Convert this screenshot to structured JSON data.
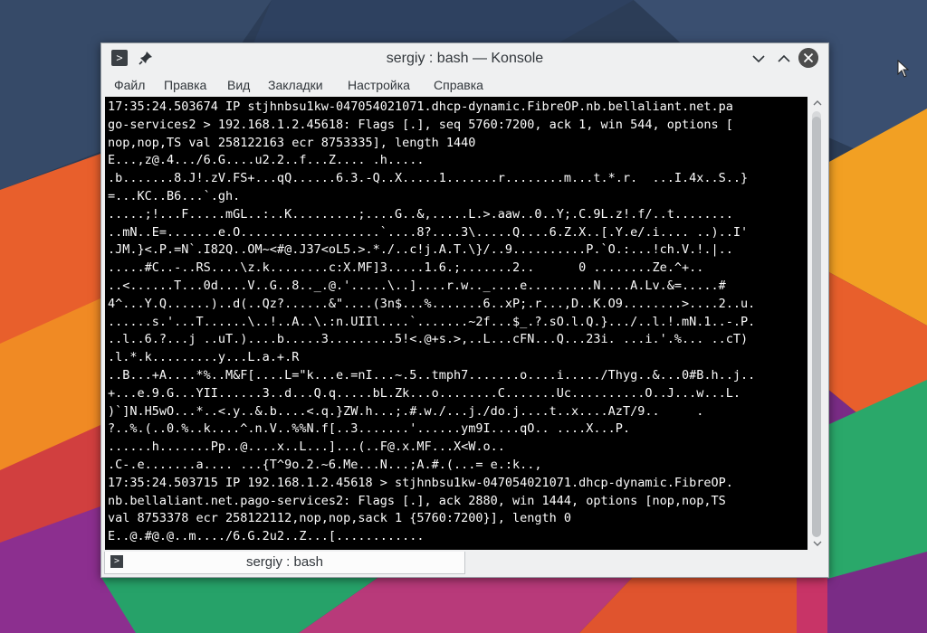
{
  "window": {
    "title": "sergiy : bash — Konsole",
    "prompt_glyph": ">"
  },
  "menu": {
    "items": [
      {
        "label": "Файл"
      },
      {
        "label": "Правка"
      },
      {
        "label": "Вид"
      },
      {
        "label": "Закладки"
      },
      {
        "label": "Настройка"
      },
      {
        "label": "Справка"
      }
    ]
  },
  "terminal": {
    "lines": [
      "17:35:24.503674 IP stjhnbsu1kw-047054021071.dhcp-dynamic.FibreOP.nb.bellaliant.net.pa",
      "go-services2 > 192.168.1.2.45618: Flags [.], seq 5760:7200, ack 1, win 544, options [",
      "nop,nop,TS val 258122163 ecr 8753335], length 1440",
      "E...,z@.4.../6.G....u2.2..f...Z.... .h.....",
      ".b.......8.J!.zV.FS+...qQ......6.3.-Q..X.....1.......r........m...t.*.r.  ...I.4x..S..}",
      "=...KC..B6...`.gh.",
      ".....;!...F.....mGL..:..K.........;....G..&,.....L.>.aaw..0..Y;.C.9L.z!.f/..t........",
      "..mN..E=.......e.O...................`....8?....3\\.....Q....6.Z.X..[.Y.e/.i.... ..)..I'",
      ".JM.}<.P.=N`.I82Q..OM~<#@.J37<oL5.>.*./..c!j.A.T.\\}/..9..........P.`O.:...!ch.V.!.|..",
      ".....#C..-..RS....\\z.k........c:X.MF]3.....1.6.;.......2..      0 ........Ze.^+..",
      "..<......T...0d....V..G..8.._.@.'.....\\..]....r.w.._....e.........N....A.Lv.&=.....#",
      "4^...Y.Q......)..d(..Qz?......&\"....(3n$...%.......6..xP;.r...,D..K.O9........>....2..u.",
      "......s.'...T......\\..!..A..\\.:n.UIIl....`.......~2f...$_.?.sO.l.Q.}.../..l.!.mN.1..-.P.",
      "..l..6.?...j ..uT.)....b.....3.........5!<.@+s.>,..L...cFN...Q...23i. ...i.'.%... ..cT)",
      ".l.*.k.........y...L.a.+.R",
      "..B...+A....*%..M&F[....L=\"k...e.=nI...~.5..tmph7.......o....i...../Thyg..&...0#B.h..j..",
      "+...e.9.G...YII......3..d...Q.q.....bL.Zk...o........C.......Uc..........O..J...w...L.",
      ")`]N.H5wO...*..<.y..&.b....<.q.}ZW.h...;.#.w./...j./do.j....t..x....AzT/9..     .",
      "?..%.(..0.%..k....^.n.V..%%N.f[..3.......'......ym9I....qO.. ....X...P.",
      "......h.......Pp..@....x..L...]...(..F@.x.MF...X<W.o..",
      ".C-.e.......a.... ...{T^9o.2.~6.Me...N...;A.#.(...= e.:k..,",
      "17:35:24.503715 IP 192.168.1.2.45618 > stjhnbsu1kw-047054021071.dhcp-dynamic.FibreOP.",
      "nb.bellaliant.net.pago-services2: Flags [.], ack 2880, win 1444, options [nop,nop,TS",
      "val 8753378 ecr 258122112,nop,nop,sack 1 {5760:7200}], length 0",
      "E..@.#@.@..m..../6.G.2u2..Z...[............"
    ]
  },
  "tabs": [
    {
      "label": "sergiy : bash",
      "icon": "terminal-icon"
    }
  ],
  "colors": {
    "terminal_bg": "#000000",
    "terminal_fg": "#fcfcfc",
    "chrome_bg": "#eff0f1",
    "text": "#31363b"
  }
}
